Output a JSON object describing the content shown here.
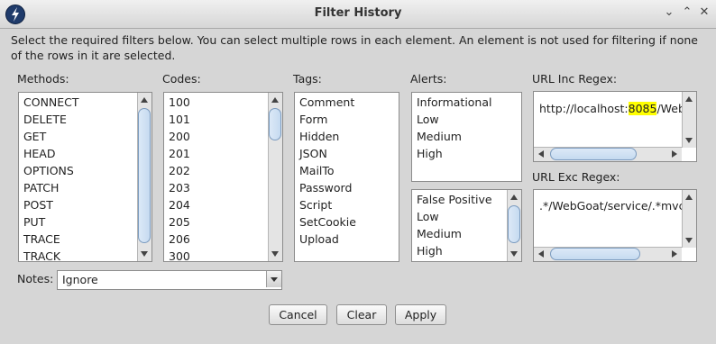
{
  "window": {
    "title": "Filter History"
  },
  "description": "Select the required filters below. You can select multiple rows in each element. An element is not used for filtering if none of the rows in it are selected.",
  "labels": {
    "methods": "Methods:",
    "codes": "Codes:",
    "tags": "Tags:",
    "alerts": "Alerts:",
    "url_inc": "URL Inc Regex:",
    "url_exc": "URL Exc Regex:",
    "notes": "Notes:"
  },
  "methods": [
    "CONNECT",
    "DELETE",
    "GET",
    "HEAD",
    "OPTIONS",
    "PATCH",
    "POST",
    "PUT",
    "TRACE",
    "TRACK"
  ],
  "codes": [
    "100",
    "101",
    "200",
    "201",
    "202",
    "203",
    "204",
    "205",
    "206",
    "300"
  ],
  "tags": [
    "Comment",
    "Form",
    "Hidden",
    "JSON",
    "MailTo",
    "Password",
    "Script",
    "SetCookie",
    "Upload"
  ],
  "alerts": [
    "Informational",
    "Low",
    "Medium",
    "High"
  ],
  "confidence": [
    "False Positive",
    "Low",
    "Medium",
    "High"
  ],
  "url_inc": {
    "before": "http://localhost:",
    "highlight": "8085",
    "after": "/Web"
  },
  "url_exc": {
    "value": ".*/WebGoat/service/.*mvc"
  },
  "notes": {
    "selected": "Ignore"
  },
  "buttons": {
    "cancel": "Cancel",
    "clear": "Clear",
    "apply": "Apply"
  },
  "icons": {
    "app": "zap-logo-icon",
    "minimize": "chevron-down-icon",
    "maximize": "chevron-up-icon",
    "close": "close-icon"
  }
}
